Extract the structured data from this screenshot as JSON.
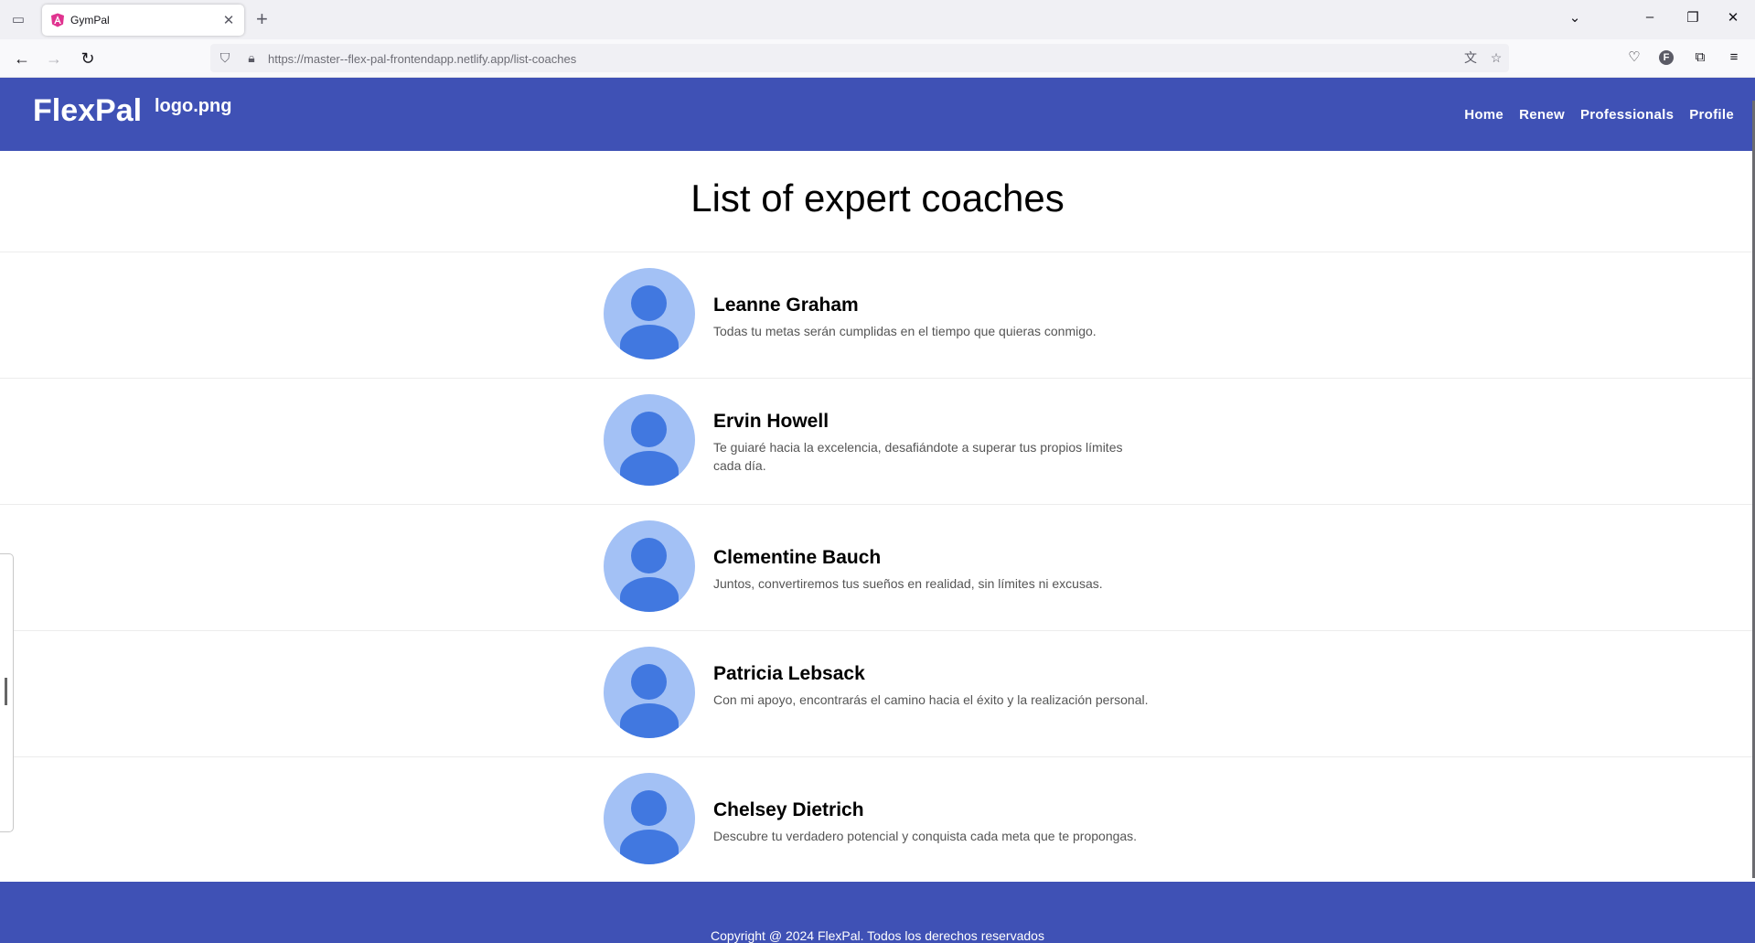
{
  "browser": {
    "tab_title": "GymPal",
    "url_host": "https://master--flex-pal-frontendapp.netlify.app",
    "url_path": "/list-coaches",
    "profile_initial": "F"
  },
  "header": {
    "brand": "FlexPal",
    "logo_alt": "logo.png",
    "nav": [
      "Home",
      "Renew",
      "Professionals",
      "Profile"
    ]
  },
  "main": {
    "title": "List of expert coaches",
    "coaches": [
      {
        "name": "Leanne Graham",
        "description": "Todas tu metas serán cumplidas en el tiempo que quieras conmigo."
      },
      {
        "name": "Ervin Howell",
        "description": "Te guiaré hacia la excelencia, desafiándote a superar tus propios límites cada día."
      },
      {
        "name": "Clementine Bauch",
        "description": "Juntos, convertiremos tus sueños en realidad, sin límites ni excusas."
      },
      {
        "name": "Patricia Lebsack",
        "description": "Con mi apoyo, encontrarás el camino hacia el éxito y la realización personal."
      },
      {
        "name": "Chelsey Dietrich",
        "description": "Descubre tu verdadero potencial y conquista cada meta que te propongas."
      }
    ]
  },
  "footer": {
    "copyright": "Copyright @ 2024 FlexPal. Todos los derechos reservados"
  },
  "colors": {
    "primary": "#3f51b5",
    "avatar_bg": "#a3c1f5",
    "avatar_fg": "#4178e0"
  }
}
